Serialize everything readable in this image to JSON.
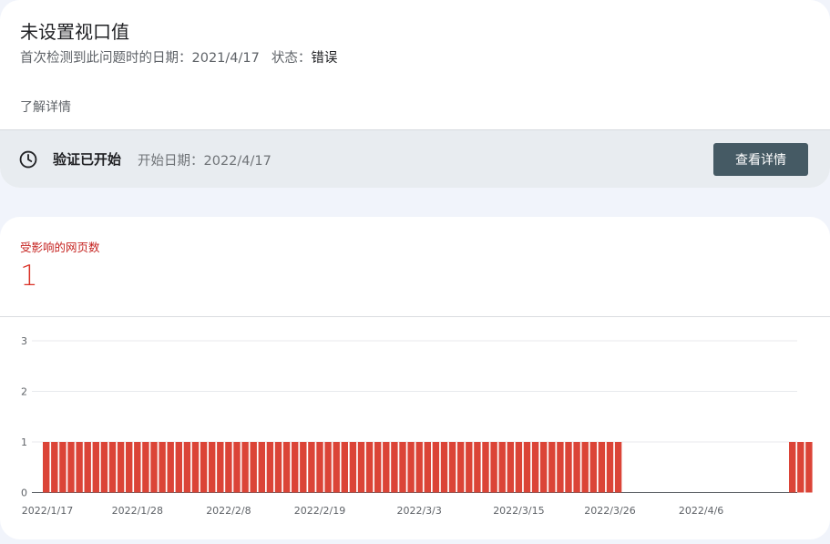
{
  "issue": {
    "title": "未设置视口值",
    "first_detected_label": "首次检测到此问题时的日期：",
    "first_detected_date": "2021/4/17",
    "status_label": "状态：",
    "status_value": "错误",
    "learn_more": "了解详情"
  },
  "validation": {
    "status": "验证已开始",
    "start_label": "开始日期：",
    "start_date": "2022/4/17",
    "details_button": "查看详情",
    "icon": "clock-icon"
  },
  "metric": {
    "label": "受影响的网页数",
    "value": "1"
  },
  "colors": {
    "bar": "#db4437",
    "accent_text": "#c5221f",
    "button": "#455a64"
  },
  "chart_data": {
    "type": "bar",
    "ylim": [
      0,
      3
    ],
    "y_ticks": [
      "0",
      "1",
      "2",
      "3"
    ],
    "x_tick_labels": [
      "2022/1/17",
      "2022/1/28",
      "2022/2/8",
      "2022/2/19",
      "2022/3/3",
      "2022/3/15",
      "2022/3/26",
      "2022/4/6"
    ],
    "grid": true,
    "categories": [
      "2022/1/17",
      "2022/1/18",
      "2022/1/19",
      "2022/1/20",
      "2022/1/21",
      "2022/1/22",
      "2022/1/23",
      "2022/1/24",
      "2022/1/25",
      "2022/1/26",
      "2022/1/27",
      "2022/1/28",
      "2022/1/29",
      "2022/1/30",
      "2022/1/31",
      "2022/2/1",
      "2022/2/2",
      "2022/2/3",
      "2022/2/4",
      "2022/2/5",
      "2022/2/6",
      "2022/2/7",
      "2022/2/8",
      "2022/2/9",
      "2022/2/10",
      "2022/2/11",
      "2022/2/12",
      "2022/2/13",
      "2022/2/14",
      "2022/2/15",
      "2022/2/16",
      "2022/2/17",
      "2022/2/18",
      "2022/2/19",
      "2022/2/20",
      "2022/2/21",
      "2022/2/22",
      "2022/2/23",
      "2022/2/24",
      "2022/2/25",
      "2022/2/26",
      "2022/2/27",
      "2022/2/28",
      "2022/3/1",
      "2022/3/2",
      "2022/3/3",
      "2022/3/4",
      "2022/3/5",
      "2022/3/6",
      "2022/3/7",
      "2022/3/8",
      "2022/3/9",
      "2022/3/10",
      "2022/3/11",
      "2022/3/12",
      "2022/3/13",
      "2022/3/14",
      "2022/3/15",
      "2022/3/16",
      "2022/3/17",
      "2022/3/18",
      "2022/3/19",
      "2022/3/20",
      "2022/3/21",
      "2022/3/22",
      "2022/3/23",
      "2022/3/24",
      "2022/3/25",
      "2022/3/26",
      "2022/3/27",
      "2022/3/28",
      "2022/3/29",
      "2022/3/30",
      "2022/3/31",
      "2022/4/1",
      "2022/4/2",
      "2022/4/3",
      "2022/4/4",
      "2022/4/5",
      "2022/4/6",
      "2022/4/7",
      "2022/4/8",
      "2022/4/9",
      "2022/4/10",
      "2022/4/11",
      "2022/4/12",
      "2022/4/13",
      "2022/4/14",
      "2022/4/15",
      "2022/4/16",
      "2022/4/17",
      "2022/4/18",
      "2022/4/19"
    ],
    "values": [
      1,
      1,
      1,
      1,
      1,
      1,
      1,
      1,
      1,
      1,
      1,
      1,
      1,
      1,
      1,
      1,
      1,
      1,
      1,
      1,
      1,
      1,
      1,
      1,
      1,
      1,
      1,
      1,
      1,
      1,
      1,
      1,
      1,
      1,
      1,
      1,
      1,
      1,
      1,
      1,
      1,
      1,
      1,
      1,
      1,
      1,
      1,
      1,
      1,
      1,
      1,
      1,
      1,
      1,
      1,
      1,
      1,
      1,
      1,
      1,
      1,
      1,
      1,
      1,
      1,
      1,
      1,
      1,
      1,
      1,
      0,
      0,
      0,
      0,
      0,
      0,
      0,
      0,
      0,
      0,
      0,
      0,
      0,
      0,
      0,
      0,
      0,
      0,
      0,
      0,
      1,
      1,
      1
    ]
  }
}
